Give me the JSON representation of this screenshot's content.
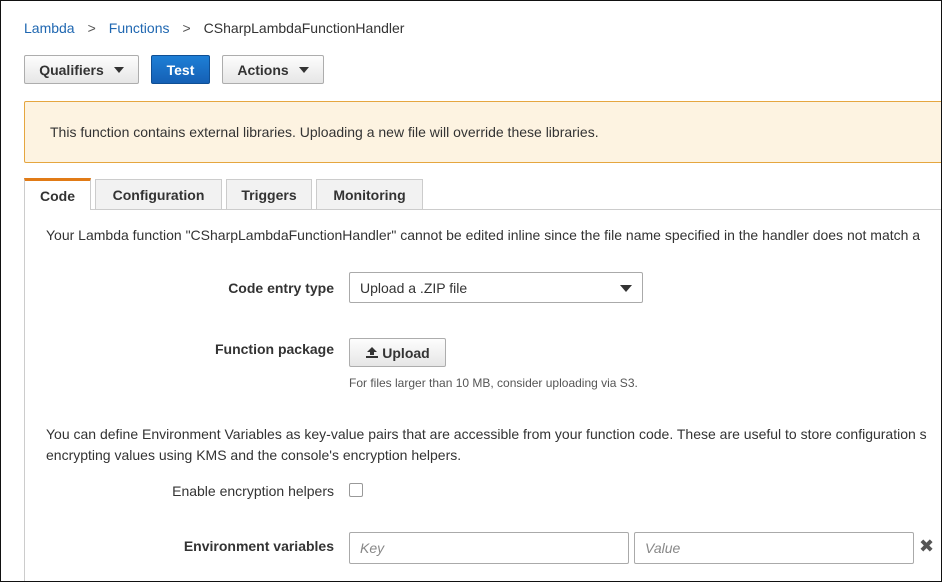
{
  "breadcrumb": {
    "lambda": "Lambda",
    "functions": "Functions",
    "current": "CSharpLambdaFunctionHandler",
    "separator": ">"
  },
  "toolbar": {
    "qualifiers": "Qualifiers",
    "test": "Test",
    "actions": "Actions"
  },
  "alert": {
    "message": "This function contains external libraries. Uploading a new file will override these libraries.",
    "background": "#fdf3e1",
    "border": "#e5a63f"
  },
  "tabs": [
    {
      "label": "Code",
      "active": true
    },
    {
      "label": "Configuration",
      "active": false
    },
    {
      "label": "Triggers",
      "active": false
    },
    {
      "label": "Monitoring",
      "active": false
    }
  ],
  "code": {
    "inline_note": "Your Lambda function \"CSharpLambdaFunctionHandler\" cannot be edited inline since the file name specified in the handler does not match a",
    "entry_type_label": "Code entry type",
    "entry_type_value": "Upload a .ZIP file",
    "package_label": "Function package",
    "upload_label": "Upload",
    "upload_help": "For files larger than 10 MB, consider uploading via S3.",
    "env_text_1": "You can define Environment Variables as key-value pairs that are accessible from your function code. These are useful to store configuration s",
    "env_text_2": "encrypting values using KMS and the console's encryption helpers.",
    "encryption_label": "Enable encryption helpers",
    "encryption_checked": false,
    "env_vars_label": "Environment variables",
    "key_placeholder": "Key",
    "value_placeholder": "Value",
    "remove_glyph": "✖"
  },
  "colors": {
    "link": "#1f67b1",
    "primary": "#1560b5",
    "active_tab": "#e17b16"
  },
  "icons": {
    "upload": "upload-icon",
    "caret": "caret-down-icon",
    "remove": "remove-icon"
  }
}
